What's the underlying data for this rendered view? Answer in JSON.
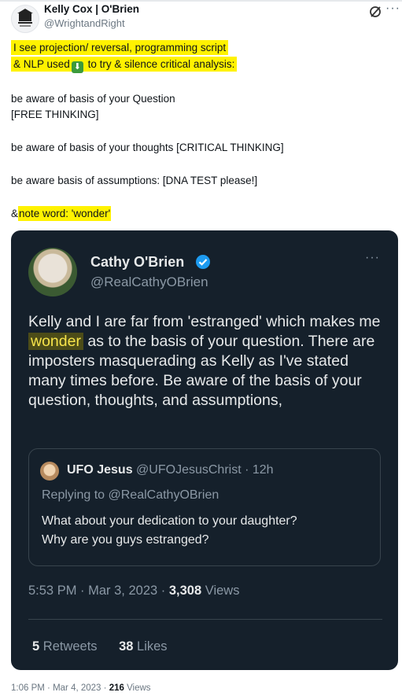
{
  "header": {
    "name": "Kelly Cox | O'Brien",
    "handle": "@WrightandRight",
    "icons": {
      "grok": "slash-circle-icon",
      "more": "more-horizontal-icon"
    }
  },
  "post": {
    "line1": "I see projection/ reversal,   programming script",
    "line2a": "& NLP used",
    "line2_icon": "down-arrow-emoji-icon",
    "line2b": " to try & silence critical analysis:",
    "line3": "be aware of basis of your Question",
    "line4": "[FREE THINKING]",
    "line5": "be aware of basis of your thoughts [CRITICAL THINKING]",
    "line6": "be aware basis of assumptions: [DNA TEST please!]",
    "line7a": "&",
    "line7b": "note word: 'wonder'"
  },
  "embedded": {
    "name": "Cathy O'Brien",
    "handle": "@RealCathyOBrien",
    "body_before": "Kelly and I are far from 'estranged' which makes me ",
    "body_highlight": "wonder",
    "body_after": " as to the basis of your question. There are imposters masquerading as Kelly as I've stated many times before. Be aware of the basis of your question, thoughts, and assumptions,",
    "quote": {
      "name": "UFO Jesus",
      "handle": "@UFOJesusChrist",
      "separator": "·",
      "age": "12h",
      "replying": "Replying to @RealCathyOBrien",
      "text_line1": "What about your dedication to your daughter?",
      "text_line2": "Why are you guys estranged?"
    },
    "time": "5:53 PM",
    "date": "Mar 3, 2023",
    "views_count": "3,308",
    "views_label": "Views",
    "retweets_count": "5",
    "retweets_label": "Retweets",
    "likes_count": "38",
    "likes_label": "Likes"
  },
  "footer": {
    "time": "1:06 PM",
    "date": "Mar 4, 2023",
    "views_count": "216",
    "views_label": "Views",
    "separator": "·"
  },
  "colors": {
    "highlight": "#fff200",
    "card_bg": "#15202b",
    "verified": "#1d9bf0"
  }
}
